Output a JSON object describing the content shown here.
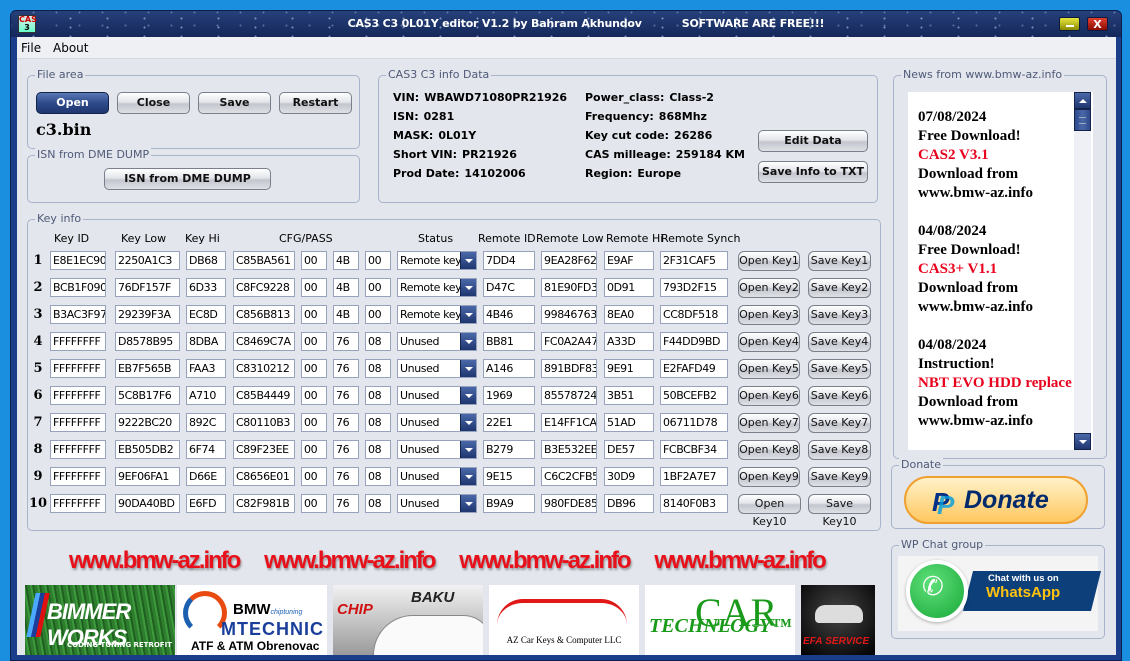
{
  "window": {
    "title": "CAS3 C3 0L01Y editor V1.2 by Bahram Akhundov",
    "subtitle": "SOFTWARE ARE FREE!!!",
    "icon_text_top": "CAS",
    "icon_text_bottom": "3",
    "close_glyph": "X"
  },
  "menu": {
    "items": [
      "File",
      "About"
    ]
  },
  "file_area": {
    "legend": "File area",
    "buttons": {
      "open": "Open",
      "close": "Close",
      "save": "Save",
      "restart": "Restart"
    },
    "filename": "c3.bin"
  },
  "isn_dump": {
    "legend": "ISN from DME DUMP",
    "button": "ISN from DME DUMP"
  },
  "info": {
    "legend": "CAS3 C3 info Data",
    "left": [
      {
        "label": "VIN:",
        "value": "WBAWD71080PR21926"
      },
      {
        "label": "ISN:",
        "value": "0281"
      },
      {
        "label": "MASK:",
        "value": "0L01Y"
      },
      {
        "label": "Short VIN:",
        "value": "PR21926"
      },
      {
        "label": "Prod Date:",
        "value": "14102006"
      }
    ],
    "right": [
      {
        "label": "Power_class:",
        "value": "Class-2"
      },
      {
        "label": "Frequency:",
        "value": "868Mhz"
      },
      {
        "label": "Key cut code:",
        "value": "26286"
      },
      {
        "label": "CAS milleage:",
        "value": "259184 KM"
      },
      {
        "label": "Region:",
        "value": "Europe"
      }
    ],
    "edit_button": "Edit Data",
    "save_txt_button": "Save Info to TXT"
  },
  "keys": {
    "legend": "Key info",
    "headers": {
      "key_id": "Key ID",
      "key_low": "Key Low",
      "key_hi": "Key Hi",
      "cfg_pass": "CFG/PASS",
      "status": "Status",
      "remote_id": "Remote ID",
      "remote_low": "Remote Low",
      "remote_hi": "Remote Hi",
      "remote_synch": "Remote Synch"
    },
    "rows": [
      {
        "num": "1",
        "key_id": "E8E1EC90",
        "key_low": "2250A1C3",
        "key_hi": "DB68",
        "cfg": "C85BA561",
        "p1": "00",
        "p2": "4B",
        "p3": "00",
        "status": "Remote key",
        "remote_id": "7DD4",
        "remote_low": "9EA28F62",
        "remote_hi": "E9AF",
        "remote_synch": "2F31CAF5",
        "open": "Open Key1",
        "save": "Save Key1"
      },
      {
        "num": "2",
        "key_id": "BCB1F090",
        "key_low": "76DF157F",
        "key_hi": "6D33",
        "cfg": "C8FC9228",
        "p1": "00",
        "p2": "4B",
        "p3": "00",
        "status": "Remote key",
        "remote_id": "D47C",
        "remote_low": "81E90FD3",
        "remote_hi": "0D91",
        "remote_synch": "793D2F15",
        "open": "Open Key2",
        "save": "Save Key2"
      },
      {
        "num": "3",
        "key_id": "B3AC3F97",
        "key_low": "29239F3A",
        "key_hi": "EC8D",
        "cfg": "C856B813",
        "p1": "00",
        "p2": "4B",
        "p3": "00",
        "status": "Remote key",
        "remote_id": "4B46",
        "remote_low": "99846763",
        "remote_hi": "8EA0",
        "remote_synch": "CC8DF518",
        "open": "Open Key3",
        "save": "Save Key3"
      },
      {
        "num": "4",
        "key_id": "FFFFFFFF",
        "key_low": "D8578B95",
        "key_hi": "8DBA",
        "cfg": "C8469C7A",
        "p1": "00",
        "p2": "76",
        "p3": "08",
        "status": "Unused",
        "remote_id": "BB81",
        "remote_low": "FC0A2A47",
        "remote_hi": "A33D",
        "remote_synch": "F44DD9BD",
        "open": "Open Key4",
        "save": "Save Key4"
      },
      {
        "num": "5",
        "key_id": "FFFFFFFF",
        "key_low": "EB7F565B",
        "key_hi": "FAA3",
        "cfg": "C8310212",
        "p1": "00",
        "p2": "76",
        "p3": "08",
        "status": "Unused",
        "remote_id": "A146",
        "remote_low": "891BDF83",
        "remote_hi": "9E91",
        "remote_synch": "E2FAFD49",
        "open": "Open Key5",
        "save": "Save Key5"
      },
      {
        "num": "6",
        "key_id": "FFFFFFFF",
        "key_low": "5C8B17F6",
        "key_hi": "A710",
        "cfg": "C85B4449",
        "p1": "00",
        "p2": "76",
        "p3": "08",
        "status": "Unused",
        "remote_id": "1969",
        "remote_low": "85578724",
        "remote_hi": "3B51",
        "remote_synch": "50BCEFB2",
        "open": "Open Key6",
        "save": "Save Key6"
      },
      {
        "num": "7",
        "key_id": "FFFFFFFF",
        "key_low": "9222BC20",
        "key_hi": "892C",
        "cfg": "C80110B3",
        "p1": "00",
        "p2": "76",
        "p3": "08",
        "status": "Unused",
        "remote_id": "22E1",
        "remote_low": "E14FF1CA",
        "remote_hi": "51AD",
        "remote_synch": "06711D78",
        "open": "Open Key7",
        "save": "Save Key7"
      },
      {
        "num": "8",
        "key_id": "FFFFFFFF",
        "key_low": "EB505DB2",
        "key_hi": "6F74",
        "cfg": "C89F23EE",
        "p1": "00",
        "p2": "76",
        "p3": "08",
        "status": "Unused",
        "remote_id": "B279",
        "remote_low": "B3E532EE",
        "remote_hi": "DE57",
        "remote_synch": "FCBCBF34",
        "open": "Open Key8",
        "save": "Save Key8"
      },
      {
        "num": "9",
        "key_id": "FFFFFFFF",
        "key_low": "9EF06FA1",
        "key_hi": "D66E",
        "cfg": "C8656E01",
        "p1": "00",
        "p2": "76",
        "p3": "08",
        "status": "Unused",
        "remote_id": "9E15",
        "remote_low": "C6C2CFB5",
        "remote_hi": "30D9",
        "remote_synch": "1BF2A7E7",
        "open": "Open Key9",
        "save": "Save Key9"
      },
      {
        "num": "10",
        "key_id": "FFFFFFFF",
        "key_low": "90DA40BD",
        "key_hi": "E6FD",
        "cfg": "C82F981B",
        "p1": "00",
        "p2": "76",
        "p3": "08",
        "status": "Unused",
        "remote_id": "B9A9",
        "remote_low": "980FDE85",
        "remote_hi": "DB96",
        "remote_synch": "8140F0B3",
        "open": "Open Key10",
        "save": "Save Key10"
      }
    ]
  },
  "news": {
    "legend": "News from www.bmw-az.info",
    "items": [
      {
        "date": "07/08/2024",
        "line1": "Free Download!",
        "highlight": "CAS2 V3.1",
        "line2": "Download from",
        "line3": "www.bmw-az.info"
      },
      {
        "date": "04/08/2024",
        "line1": "Free Download!",
        "highlight": "CAS3+ V1.1",
        "line2": "Download from",
        "line3": "www.bmw-az.info"
      },
      {
        "date": "04/08/2024",
        "line1": "Instruction!",
        "highlight": "NBT EVO HDD replace",
        "line2": "Download from",
        "line3": "www.bmw-az.info"
      }
    ]
  },
  "donate": {
    "legend": "Donate",
    "button": "Donate",
    "brand_glyph": "P"
  },
  "whatsapp": {
    "legend": "WP Chat group",
    "line1": "Chat with us on",
    "line2": "WhatsApp",
    "phone_glyph": "✆"
  },
  "banner": {
    "links": [
      "www.bmw-az.info",
      "www.bmw-az.info",
      "www.bmw-az.info",
      "www.bmw-az.info"
    ]
  },
  "sponsors": {
    "bimmer": {
      "title": "BIMMER WORKS",
      "tagline": "CODING TUNING RETROFIT"
    },
    "mtech": {
      "brand": "BMW",
      "sub": "chiptuning",
      "name": "MTECHNIC",
      "tagline": "ATF & ATM Obrenovac"
    },
    "chip": {
      "left": "CHIP",
      "right": "BAKU"
    },
    "az": {
      "name": "AZ Car Keys & Computer LLC"
    },
    "techno": {
      "prefix": "TECHN",
      "big": "CAR",
      "suffix": "LOGY™"
    },
    "efa": {
      "a": "EFA",
      "b": "SERVICE"
    }
  },
  "colors": {
    "accent": "#1f3670",
    "news_highlight": "#e8001c",
    "banner_red": "#e8101a",
    "window_frame": "#1a3e8a"
  }
}
